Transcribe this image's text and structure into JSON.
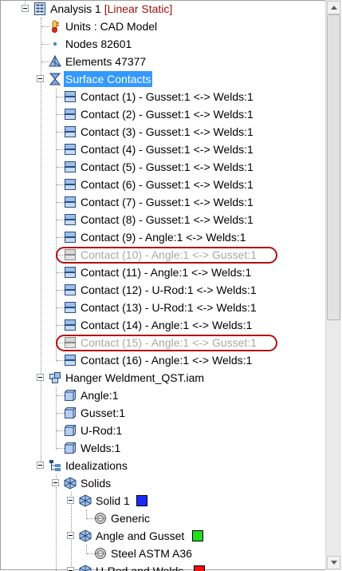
{
  "analysis": {
    "name": "Analysis 1",
    "type": "[Linear Static]"
  },
  "units": "Units : CAD Model",
  "nodes": "Nodes 82601",
  "elements": "Elements 47377",
  "surface_contacts": {
    "label": "Surface Contacts",
    "items": [
      {
        "label": "Contact (1) - Gusset:1 <-> Welds:1",
        "suppressed": false
      },
      {
        "label": "Contact (2) - Gusset:1 <-> Welds:1",
        "suppressed": false
      },
      {
        "label": "Contact (3) - Gusset:1 <-> Welds:1",
        "suppressed": false
      },
      {
        "label": "Contact (4) - Gusset:1 <-> Welds:1",
        "suppressed": false
      },
      {
        "label": "Contact (5) - Gusset:1 <-> Welds:1",
        "suppressed": false
      },
      {
        "label": "Contact (6) - Gusset:1 <-> Welds:1",
        "suppressed": false
      },
      {
        "label": "Contact (7) - Gusset:1 <-> Welds:1",
        "suppressed": false
      },
      {
        "label": "Contact (8) - Gusset:1 <-> Welds:1",
        "suppressed": false
      },
      {
        "label": "Contact (9) - Angle:1 <-> Welds:1",
        "suppressed": false
      },
      {
        "label": "Contact (10) - Angle:1 <-> Gusset:1",
        "suppressed": true
      },
      {
        "label": "Contact (11) - Angle:1 <-> Welds:1",
        "suppressed": false
      },
      {
        "label": "Contact (12) - U-Rod:1 <-> Welds:1",
        "suppressed": false
      },
      {
        "label": "Contact (13) - U-Rod:1 <-> Welds:1",
        "suppressed": false
      },
      {
        "label": "Contact (14) - Angle:1 <-> Welds:1",
        "suppressed": false
      },
      {
        "label": "Contact (15) - Angle:1 <-> Gusset:1",
        "suppressed": true
      },
      {
        "label": "Contact (16) - Angle:1 <-> Welds:1",
        "suppressed": false
      }
    ]
  },
  "assembly": {
    "label": "Hanger Weldment_QST.iam",
    "parts": [
      "Angle:1",
      "Gusset:1",
      "U-Rod:1",
      "Welds:1"
    ]
  },
  "idealizations": {
    "label": "Idealizations",
    "solids": {
      "label": "Solids",
      "groups": [
        {
          "label": "Solid 1",
          "color": "#1a2bff",
          "material": "Generic"
        },
        {
          "label": "Angle and Gusset",
          "color": "#22dd22",
          "material": "Steel ASTM A36"
        },
        {
          "label": "U-Rod and Welds",
          "color": "#ee1111"
        }
      ]
    }
  },
  "colors": {
    "selection": "#3399ff",
    "highlight_oval": "#b01010",
    "suppressed_text": "#a8a8a8",
    "analysis_type": "#a01010"
  }
}
